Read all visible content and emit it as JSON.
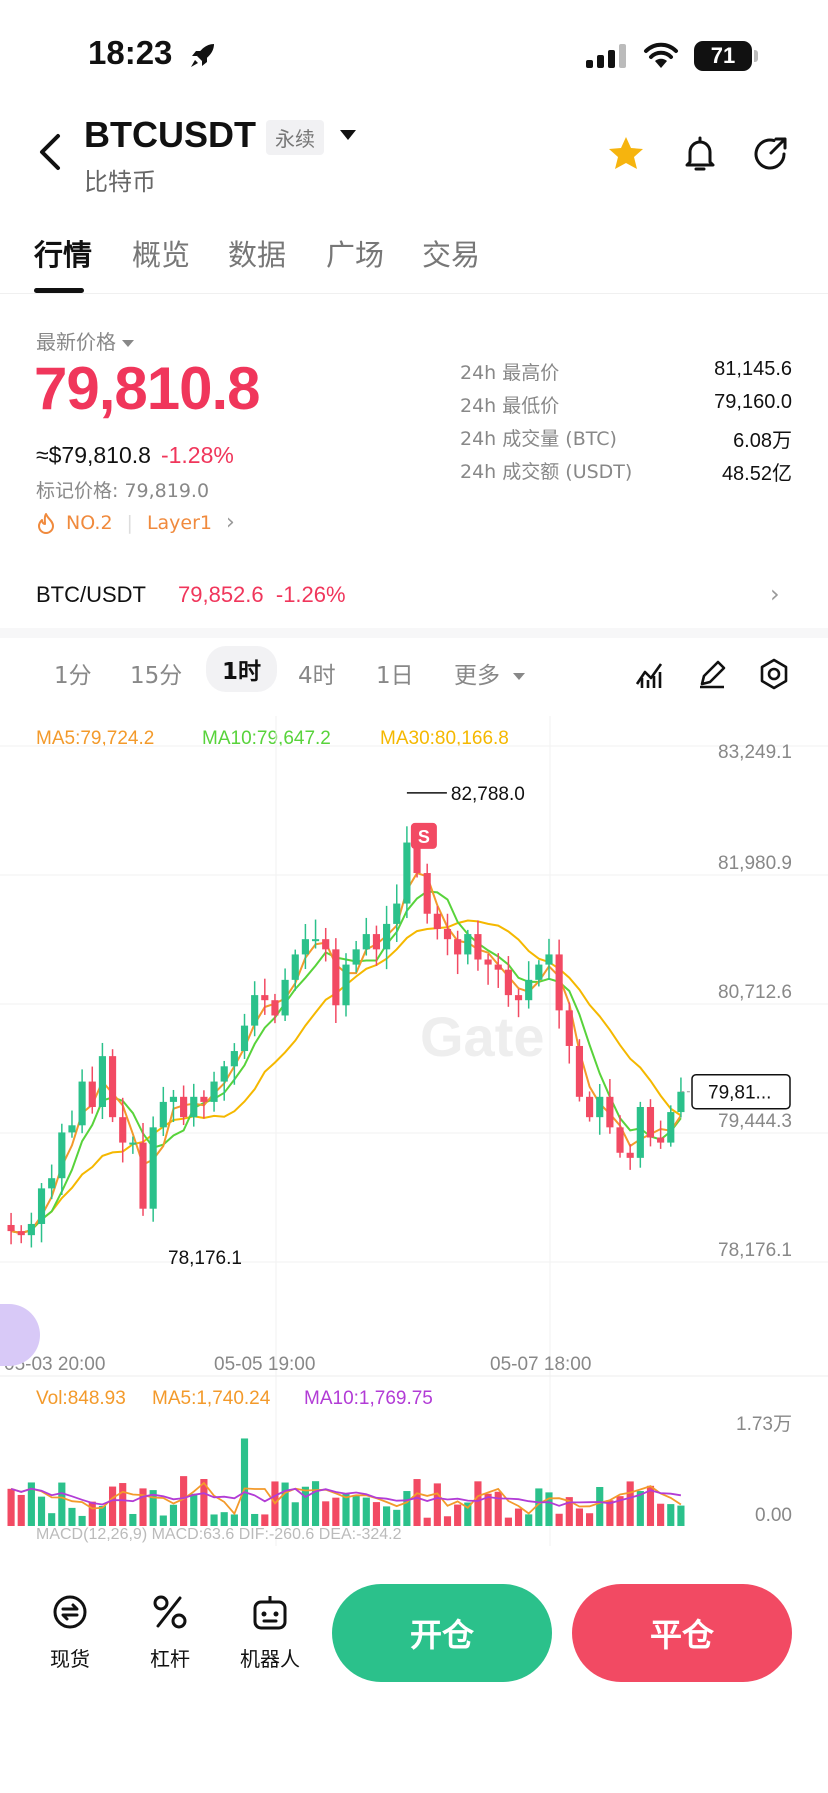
{
  "status": {
    "time": "18:23",
    "battery": "71"
  },
  "header": {
    "symbol": "BTCUSDT",
    "contract_type": "永续",
    "name": "比特币"
  },
  "tabs": [
    "行情",
    "概览",
    "数据",
    "广场",
    "交易"
  ],
  "price": {
    "latest_label": "最新价格",
    "last": "79,810.8",
    "usd": "≈$79,810.8",
    "change": "-1.28%",
    "mark": "标记价格: 79,819.0",
    "rank": "NO.2",
    "sector": "Layer1"
  },
  "stats": [
    {
      "label": "24h 最高价",
      "value": "81,145.6"
    },
    {
      "label": "24h 最低价",
      "value": "79,160.0"
    },
    {
      "label": "24h 成交量 (BTC)",
      "value": "6.08万"
    },
    {
      "label": "24h 成交额 (USDT)",
      "value": "48.52亿"
    }
  ],
  "spot_pair": {
    "name": "BTC/USDT",
    "price": "79,852.6",
    "change": "-1.26%"
  },
  "intervals": [
    "1分",
    "15分",
    "1时",
    "4时",
    "1日",
    "更多"
  ],
  "active_interval": "1时",
  "indicators": {
    "ma5": "MA5:79,724.2",
    "ma10": "MA10:79,647.2",
    "ma30": "MA30:80,166.8",
    "vol": "Vol:848.93",
    "vol_ma5": "MA5:1,740.24",
    "vol_ma10": "MA10:1,769.75",
    "macd": "MACD(12,26,9)  MACD:63.6  DIF:-260.6  DEA:-324.2"
  },
  "colors": {
    "up": "#2bc18b",
    "down": "#f24a63",
    "ma5": "#f39a2b",
    "ma10": "#58d33b",
    "ma30": "#f5b800",
    "vol_ma10": "#b23cd6"
  },
  "chart_data": {
    "type": "candlestick",
    "y_ticks": [
      "83,249.1",
      "81,980.9",
      "80,712.6",
      "79,444.3",
      "78,176.1"
    ],
    "x_ticks": [
      "05-03 20:00",
      "05-05 19:00",
      "05-07 18:00"
    ],
    "ylim": [
      78176.1,
      83249.1
    ],
    "high_marker": "82,788.0",
    "low_marker": "78,176.1",
    "current_price_label": "79,81...",
    "vol_ticks": [
      "1.73万",
      "0.00"
    ],
    "sell_marker": "S",
    "close_path": [
      78480,
      78440,
      78550,
      78900,
      79000,
      79450,
      79520,
      79950,
      79700,
      80200,
      79600,
      79350,
      79350,
      78700,
      79500,
      79750,
      79800,
      79600,
      79800,
      79750,
      79950,
      80100,
      80250,
      80500,
      80800,
      80750,
      80600,
      80950,
      81200,
      81350,
      81350,
      81250,
      80700,
      81100,
      81250,
      81400,
      81250,
      81500,
      81700,
      82300,
      82000,
      81600,
      81450,
      81350,
      81200,
      81400,
      81150,
      81100,
      81050,
      80800,
      80750,
      80950,
      81100,
      81200,
      80650,
      80300,
      79800,
      79600,
      79800,
      79500,
      79250,
      79200,
      79700,
      79400,
      79350,
      79650,
      79850
    ]
  },
  "bottom_bar": {
    "spot": "现货",
    "leverage": "杠杆",
    "bot": "机器人",
    "open": "开仓",
    "close": "平仓"
  }
}
